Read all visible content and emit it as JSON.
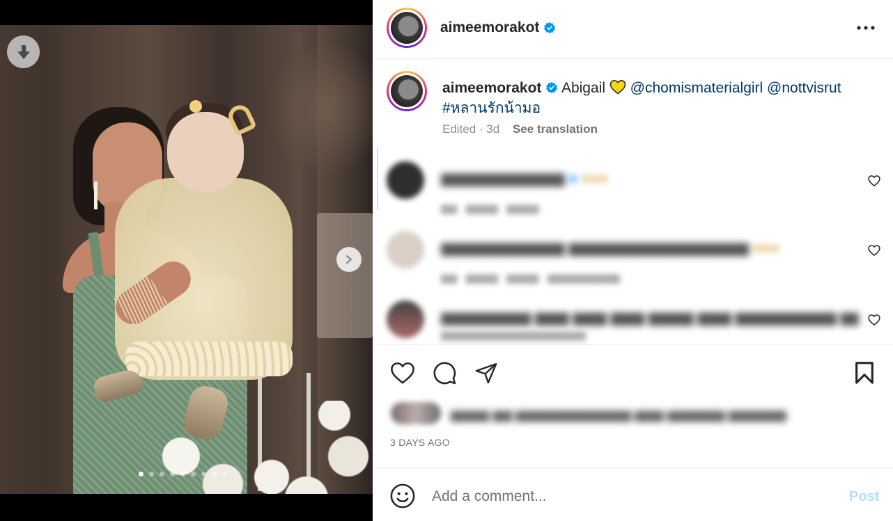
{
  "post": {
    "username": "aimeemorakot",
    "verified": true,
    "more_icon": "more-horizontal-icon"
  },
  "media": {
    "download_icon": "download-icon",
    "next_icon": "chevron-right-icon",
    "carousel_count": 9,
    "carousel_active_index": 0
  },
  "caption": {
    "username": "aimeemorakot",
    "text": "Abigail",
    "emoji": "yellow-heart",
    "mention1": "@chomismaterialgirl",
    "mention2": "@nottvisrut",
    "hashtag": "#หลานรักน้ามอ",
    "edited": "Edited · 3d",
    "see_translation": "See translation"
  },
  "actions": {
    "like_icon": "heart-icon",
    "comment_icon": "comment-icon",
    "share_icon": "send-icon",
    "save_icon": "bookmark-icon"
  },
  "date": "3 DAYS AGO",
  "comment_box": {
    "emoji_icon": "smiley-icon",
    "placeholder": "Add a comment...",
    "post_label": "Post"
  },
  "colors": {
    "link": "#00376b",
    "verified": "#0095f6",
    "post_disabled": "#b2dffc",
    "meta": "#8e8e8e"
  }
}
